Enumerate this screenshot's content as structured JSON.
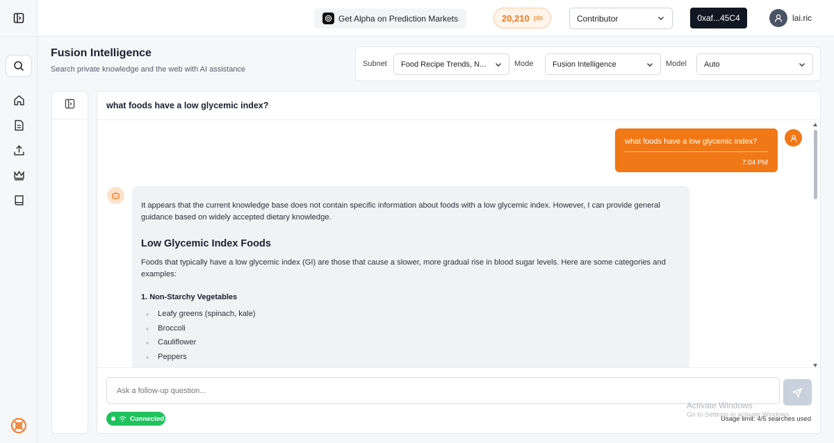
{
  "topbar": {
    "alpha_label": "Get Alpha on Prediction Markets",
    "points_value": "20,210",
    "points_unit": "pts",
    "role": "Contributor",
    "wallet": "0xaf...45C4",
    "username": "lai.ric"
  },
  "header": {
    "title": "Fusion Intelligence",
    "subtitle": "Search private knowledge and the web with AI assistance"
  },
  "controls": {
    "subnet_label": "Subnet",
    "subnet_value": "Food Recipe Trends, N...",
    "mode_label": "Mode",
    "mode_value": "Fusion Intelligence",
    "model_label": "Model",
    "model_value": "Auto"
  },
  "chat": {
    "heading": "what foods have a low glycemic index?",
    "user_message": {
      "text": "what foods have a low glycemic index?",
      "time": "7:04 PM"
    },
    "bot_message": {
      "intro": "It appears that the current knowledge base does not contain specific information about foods with a low glycemic index. However, I can provide general guidance based on widely accepted dietary knowledge.",
      "heading": "Low Glycemic Index Foods",
      "para": "Foods that typically have a low glycemic index (GI) are those that cause a slower, more gradual rise in blood sugar levels. Here are some categories and examples:",
      "section1": "1. Non-Starchy Vegetables",
      "items": [
        "Leafy greens (spinach, kale)",
        "Broccoli",
        "Cauliflower",
        "Peppers"
      ]
    }
  },
  "composer": {
    "placeholder": "Ask a follow-up question...",
    "status": "Connected",
    "usage": "Usage limit: 4/5 searches used"
  },
  "watermark": {
    "line1": "Activate Windows",
    "line2": "Go to Settings to activate Windows."
  },
  "colors": {
    "accent": "#f17816",
    "connected": "#21c25e",
    "wallet_bg": "#111722"
  }
}
